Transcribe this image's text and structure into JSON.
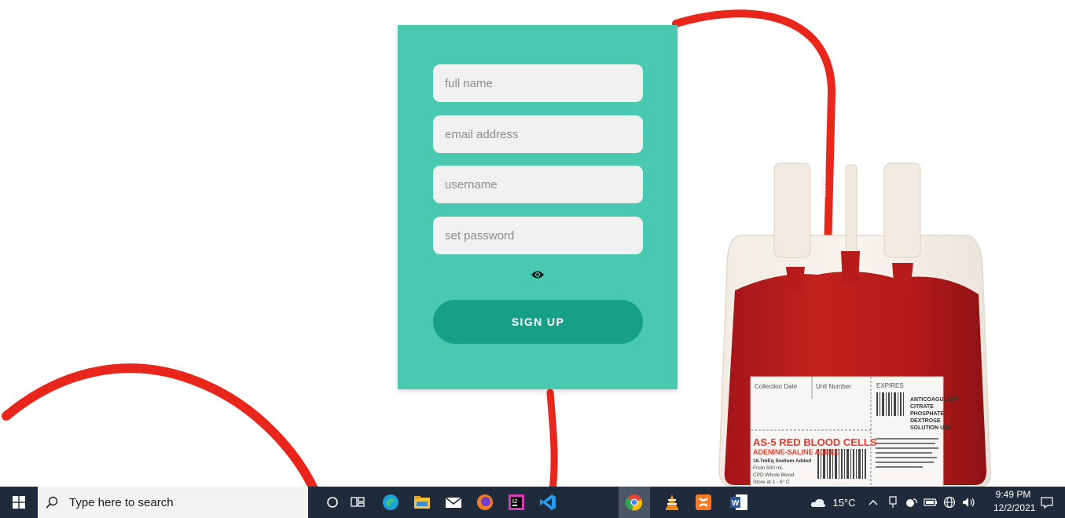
{
  "form": {
    "full_name_placeholder": "full name",
    "email_placeholder": "email address",
    "username_placeholder": "username",
    "password_placeholder": "set password",
    "signup_label": "SIGN UP",
    "toggle_password_icon": "eye-icon"
  },
  "blood_bag_label": {
    "collection_date": "Collection Date",
    "unit_number": "Unit Number",
    "expires": "EXPIRES",
    "anticoagulant": [
      "ANTICOAGULANT",
      "CITRATE",
      "PHOSPHATE",
      "DEXTROSE",
      "SOLUTION USP"
    ],
    "product_title": "AS-5 RED BLOOD CELLS",
    "product_subtitle": "ADENINE-SALINE ADDED",
    "sodium": "16.7mEq Sodium Added",
    "from": "From 500 mL",
    "whole_blood": "CPD Whole Blood",
    "store": "Store at 1 - 6° C",
    "tube_number": "65915068"
  },
  "taskbar": {
    "search_placeholder": "Type here to search",
    "temperature": "15°C",
    "time": "9:49 PM",
    "date": "12/2/2021"
  },
  "colors": {
    "card": "#48c9b0",
    "button": "#16a085",
    "tube": "#e8261b",
    "taskbar": "#1f2b3a"
  }
}
